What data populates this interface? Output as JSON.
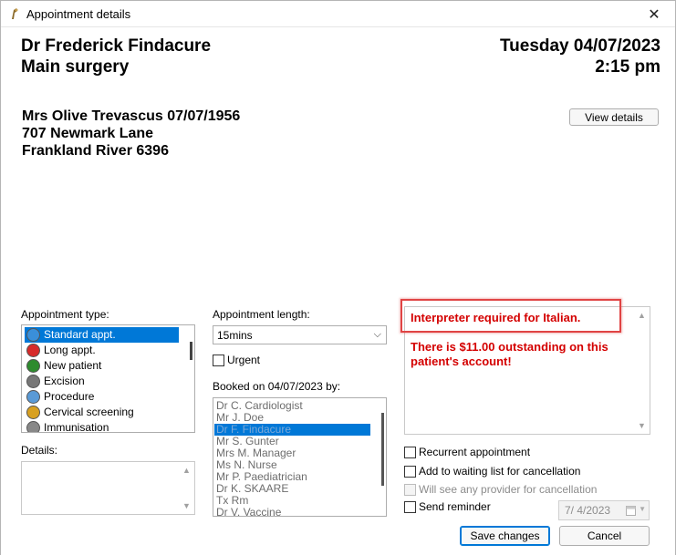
{
  "window": {
    "title": "Appointment details",
    "close": "✕"
  },
  "header": {
    "doctor": "Dr Frederick Findacure",
    "location": "Main surgery",
    "date": "Tuesday 04/07/2023",
    "time": "2:15 pm"
  },
  "patient": {
    "name_dob": "Mrs Olive Trevascus  07/07/1956",
    "address1": "707 Newmark Lane",
    "address2": "Frankland River  6396",
    "view_details": "View details"
  },
  "appointment_type": {
    "label": "Appointment type:",
    "items": [
      {
        "label": "Standard appt.",
        "icon": "clock-icon",
        "color": "#3a8fd9",
        "selected": true
      },
      {
        "label": "Long appt.",
        "icon": "long-appt-icon",
        "color": "#d62a2a"
      },
      {
        "label": "New patient",
        "icon": "new-patient-icon",
        "color": "#2e8b2e"
      },
      {
        "label": "Excision",
        "icon": "excision-icon",
        "color": "#777777"
      },
      {
        "label": "Procedure",
        "icon": "procedure-icon",
        "color": "#5a9ad6"
      },
      {
        "label": "Cervical screening",
        "icon": "cervical-icon",
        "color": "#d8a020"
      },
      {
        "label": "Immunisation",
        "icon": "syringe-icon",
        "color": "#888888"
      }
    ]
  },
  "details": {
    "label": "Details:"
  },
  "appointment_length": {
    "label": "Appointment length:",
    "value": "15mins"
  },
  "urgent": {
    "label": "Urgent"
  },
  "booked_by": {
    "label": "Booked on 04/07/2023 by:",
    "items": [
      {
        "label": "Dr C. Cardiologist"
      },
      {
        "label": "Mr J. Doe"
      },
      {
        "label": "Dr F. Findacure",
        "selected": true
      },
      {
        "label": "Mr S. Gunter"
      },
      {
        "label": "Mrs M. Manager"
      },
      {
        "label": "Ms N. Nurse"
      },
      {
        "label": "Mr P. Paediatrician"
      },
      {
        "label": "Dr K. SKAARE"
      },
      {
        "label": "Tx Rm"
      },
      {
        "label": "Dr V. Vaccine"
      }
    ]
  },
  "alerts": {
    "interpreter": "Interpreter required for Italian.",
    "outstanding1": "There is $11.00 outstanding on this",
    "outstanding2": "patient's account!"
  },
  "options": {
    "recurrent": "Recurrent appointment",
    "waiting_list": "Add to waiting list for cancellation",
    "any_provider": "Will see any provider for cancellation",
    "send_reminder": "Send reminder",
    "reminder_date": "7/  4/2023"
  },
  "buttons": {
    "save": "Save changes",
    "cancel": "Cancel"
  }
}
